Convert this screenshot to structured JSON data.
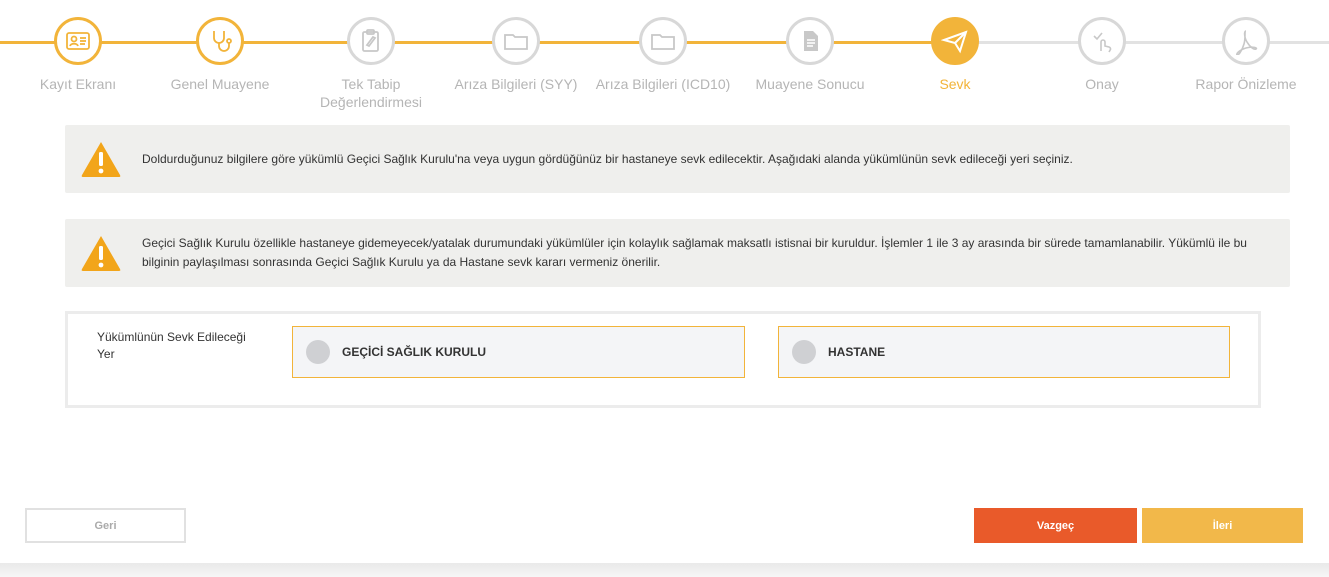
{
  "stepper": {
    "steps": [
      {
        "label": "Kayıt Ekranı",
        "icon": "id-card-icon",
        "state": "done"
      },
      {
        "label": "Genel Muayene",
        "icon": "stethoscope-icon",
        "state": "done"
      },
      {
        "label": "Tek Tabip Değerlendirmesi",
        "icon": "clipboard-icon",
        "state": "todo"
      },
      {
        "label": "Arıza Bilgileri (SYY)",
        "icon": "folder-icon",
        "state": "todo"
      },
      {
        "label": "Arıza Bilgileri (ICD10)",
        "icon": "folder-icon",
        "state": "todo"
      },
      {
        "label": "Muayene Sonucu",
        "icon": "document-icon",
        "state": "todo"
      },
      {
        "label": "Sevk",
        "icon": "paper-plane-icon",
        "state": "active"
      },
      {
        "label": "Onay",
        "icon": "tap-check-icon",
        "state": "todo"
      },
      {
        "label": "Rapor Önizleme",
        "icon": "pdf-icon",
        "state": "todo"
      }
    ],
    "accent_color": "#f2b43a",
    "inactive_color": "#d8d8d8"
  },
  "alerts": [
    {
      "icon": "warning-icon",
      "text": "Doldurduğunuz bilgilere göre yükümlü Geçici Sağlık Kurulu'na veya uygun gördüğünüz bir hastaneye sevk edilecektir. Aşağıdaki alanda yükümlünün sevk edileceği yeri seçiniz."
    },
    {
      "icon": "warning-icon",
      "text": "Geçici Sağlık Kurulu özellikle hastaneye gidemeyecek/yatalak durumundaki yükümlüler için kolaylık sağlamak maksatlı istisnai bir kuruldur. İşlemler 1 ile 3 ay arasında bir sürede tamamlanabilir. Yükümlü ile bu bilginin paylaşılması sonrasında Geçici Sağlık Kurulu ya da Hastane sevk kararı vermeniz önerilir."
    }
  ],
  "referral": {
    "label": "Yükümlünün Sevk Edileceği Yer",
    "options": [
      {
        "label": "GEÇİCİ SAĞLIK KURULU",
        "selected": false
      },
      {
        "label": "HASTANE",
        "selected": false
      }
    ]
  },
  "buttons": {
    "back": "Geri",
    "cancel": "Vazgeç",
    "next": "İleri",
    "cancel_color": "#e95a2a",
    "next_color": "#f2b84a"
  }
}
